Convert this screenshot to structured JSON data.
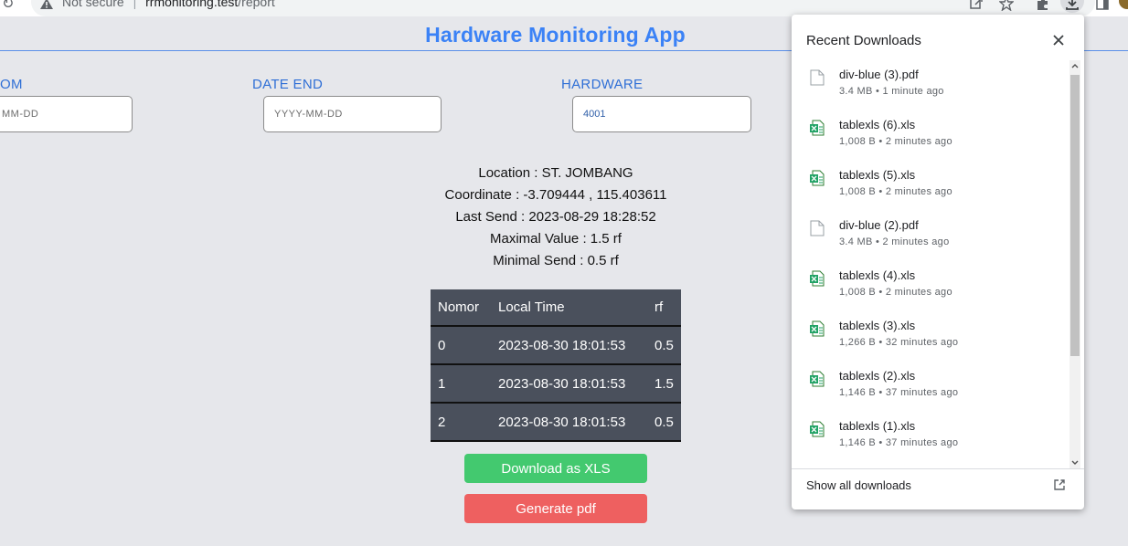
{
  "browser": {
    "security_label": "Not secure",
    "separator": "|",
    "url_host": "rrmonitoring.test",
    "url_path": "/report"
  },
  "page": {
    "title": "Hardware Monitoring App",
    "date_from_label": "OM",
    "date_from_placeholder": "MM-DD",
    "date_end_label": "DATE END",
    "date_end_placeholder": "YYYY-MM-DD",
    "hardware_label": "HARDWARE",
    "hardware_value": "4001"
  },
  "info": {
    "location": "Location : ST. JOMBANG",
    "coordinate": "Coordinate : -3.709444 , 115.403611",
    "last_send": "Last Send : 2023-08-29 18:28:52",
    "maximal_value": "Maximal Value : 1.5 rf",
    "minimal_send": "Minimal Send : 0.5 rf"
  },
  "table": {
    "headers": [
      "Nomor",
      "Local Time",
      "rf"
    ],
    "rows": [
      [
        "0",
        "2023-08-30 18:01:53",
        "0.5"
      ],
      [
        "1",
        "2023-08-30 18:01:53",
        "1.5"
      ],
      [
        "2",
        "2023-08-30 18:01:53",
        "0.5"
      ]
    ]
  },
  "buttons": {
    "download_xls": "Download as XLS",
    "generate_pdf": "Generate pdf"
  },
  "downloads": {
    "title": "Recent Downloads",
    "footer": "Show all downloads",
    "items": [
      {
        "name": "div-blue (3).pdf",
        "meta": "3.4 MB • 1 minute ago",
        "icon": "pdf-file-icon"
      },
      {
        "name": "tablexls (6).xls",
        "meta": "1,008 B • 2 minutes ago",
        "icon": "excel-file-icon"
      },
      {
        "name": "tablexls (5).xls",
        "meta": "1,008 B • 2 minutes ago",
        "icon": "excel-file-icon"
      },
      {
        "name": "div-blue (2).pdf",
        "meta": "3.4 MB • 2 minutes ago",
        "icon": "pdf-file-icon"
      },
      {
        "name": "tablexls (4).xls",
        "meta": "1,008 B • 2 minutes ago",
        "icon": "excel-file-icon"
      },
      {
        "name": "tablexls (3).xls",
        "meta": "1,266 B • 32 minutes ago",
        "icon": "excel-file-icon"
      },
      {
        "name": "tablexls (2).xls",
        "meta": "1,146 B • 37 minutes ago",
        "icon": "excel-file-icon"
      },
      {
        "name": "tablexls (1).xls",
        "meta": "1,146 B • 37 minutes ago",
        "icon": "excel-file-icon"
      }
    ]
  },
  "colors": {
    "accent_blue": "#3b82f6",
    "table_bg": "#4a505c",
    "xls_button": "#43c96f",
    "pdf_button": "#ee6060"
  }
}
